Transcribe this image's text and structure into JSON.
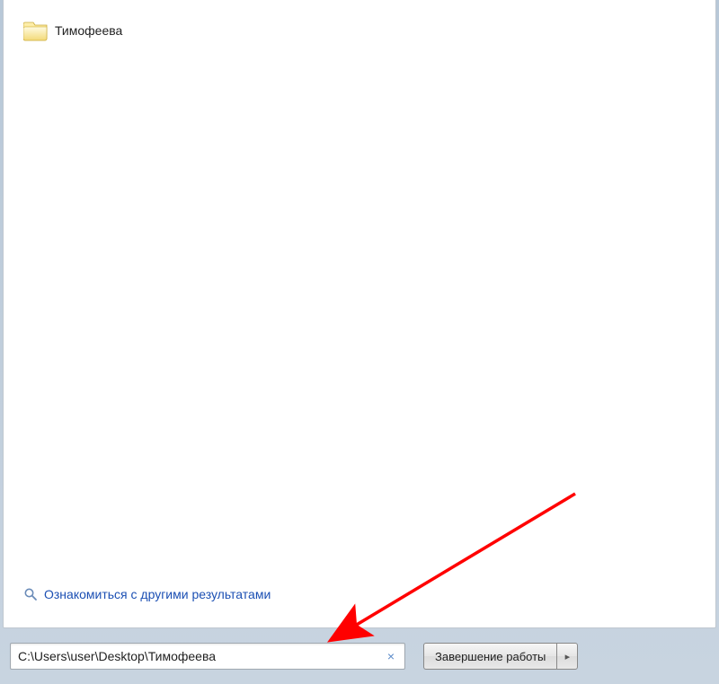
{
  "result": {
    "folder_label": "Тимофеева"
  },
  "more_results": {
    "text": "Ознакомиться с другими результатами"
  },
  "search": {
    "value": "C:\\Users\\user\\Desktop\\Тимофеева",
    "clear_symbol": "×"
  },
  "shutdown": {
    "label": "Завершение работы",
    "arrow": "▸"
  }
}
